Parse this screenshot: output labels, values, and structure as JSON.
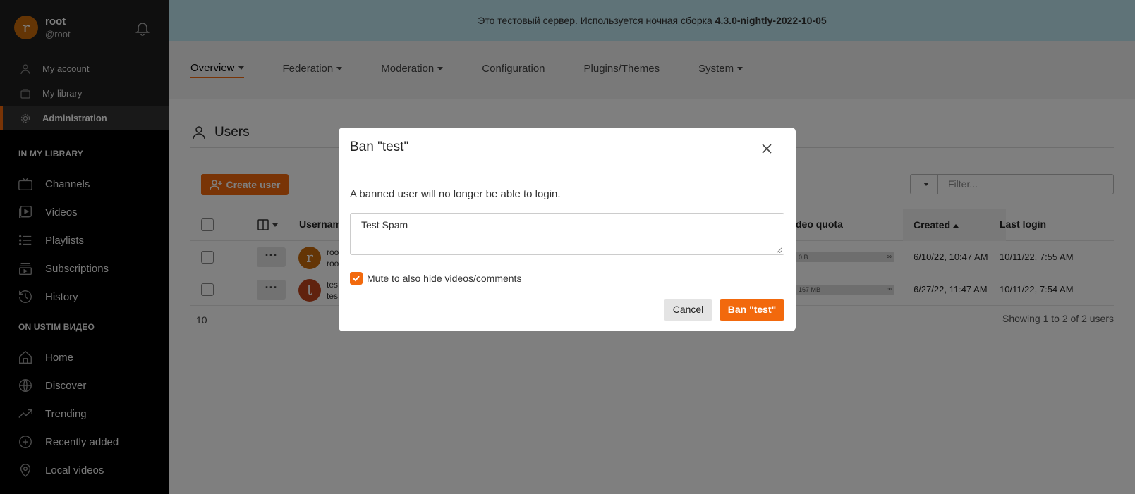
{
  "account": {
    "avatar_letter": "r",
    "name": "root",
    "handle": "@root"
  },
  "submenu": [
    {
      "label": "My account",
      "icon": "user-icon"
    },
    {
      "label": "My library",
      "icon": "library-icon"
    },
    {
      "label": "Administration",
      "icon": "gear-icon",
      "active": true
    }
  ],
  "sections": {
    "library_title": "IN MY LIBRARY",
    "library_items": [
      {
        "label": "Channels",
        "icon": "tv-icon"
      },
      {
        "label": "Videos",
        "icon": "videos-icon"
      },
      {
        "label": "Playlists",
        "icon": "list-icon"
      },
      {
        "label": "Subscriptions",
        "icon": "subscriptions-icon"
      },
      {
        "label": "History",
        "icon": "history-icon"
      }
    ],
    "instance_title": "ON USTIM ВИДЕО",
    "instance_items": [
      {
        "label": "Home",
        "icon": "home-icon"
      },
      {
        "label": "Discover",
        "icon": "globe-icon"
      },
      {
        "label": "Trending",
        "icon": "trending-icon"
      },
      {
        "label": "Recently added",
        "icon": "plus-circle-icon"
      },
      {
        "label": "Local videos",
        "icon": "location-icon"
      }
    ]
  },
  "banner": {
    "text": "Это тестовый сервер. Используется ночная сборка ",
    "version": "4.3.0-nightly-2022-10-05"
  },
  "topnav": {
    "tabs": [
      {
        "label": "Overview",
        "dropdown": true,
        "active": true
      },
      {
        "label": "Federation",
        "dropdown": true
      },
      {
        "label": "Moderation",
        "dropdown": true
      },
      {
        "label": "Configuration",
        "dropdown": false
      },
      {
        "label": "Plugins/Themes",
        "dropdown": false
      },
      {
        "label": "System",
        "dropdown": true
      }
    ]
  },
  "page": {
    "title": "Users",
    "create_label": "Create user",
    "filter_placeholder": "Filter..."
  },
  "table": {
    "headers": {
      "username": "Usernam",
      "video_quota": "Video quota",
      "created": "Created",
      "last_login": "Last login"
    },
    "rows": [
      {
        "avatar_letter": "r",
        "avatar_color": "#c86b0a",
        "name": "roo",
        "sub": "roo",
        "quota": "0 B",
        "created": "6/10/22, 10:47 AM",
        "last_login": "10/11/22, 7:55 AM"
      },
      {
        "avatar_letter": "t",
        "avatar_color": "#c0451d",
        "name": "tes",
        "sub": "tes",
        "quota": "167 MB",
        "created": "6/27/22, 11:47 AM",
        "last_login": "10/11/22, 7:54 AM"
      }
    ],
    "per_page": "10",
    "showing": "Showing 1 to 2 of 2 users",
    "quota_infinite": "∞"
  },
  "modal": {
    "title": "Ban \"test\"",
    "description": "A banned user will no longer be able to login.",
    "reason_value": "Test Spam",
    "mute_label": "Mute to also hide videos/comments",
    "mute_checked": true,
    "cancel_label": "Cancel",
    "ban_label": "Ban \"test\""
  },
  "colors": {
    "accent": "#f2690d",
    "banner_bg": "#bfe6f0",
    "sidebar_bg": "#000000"
  }
}
